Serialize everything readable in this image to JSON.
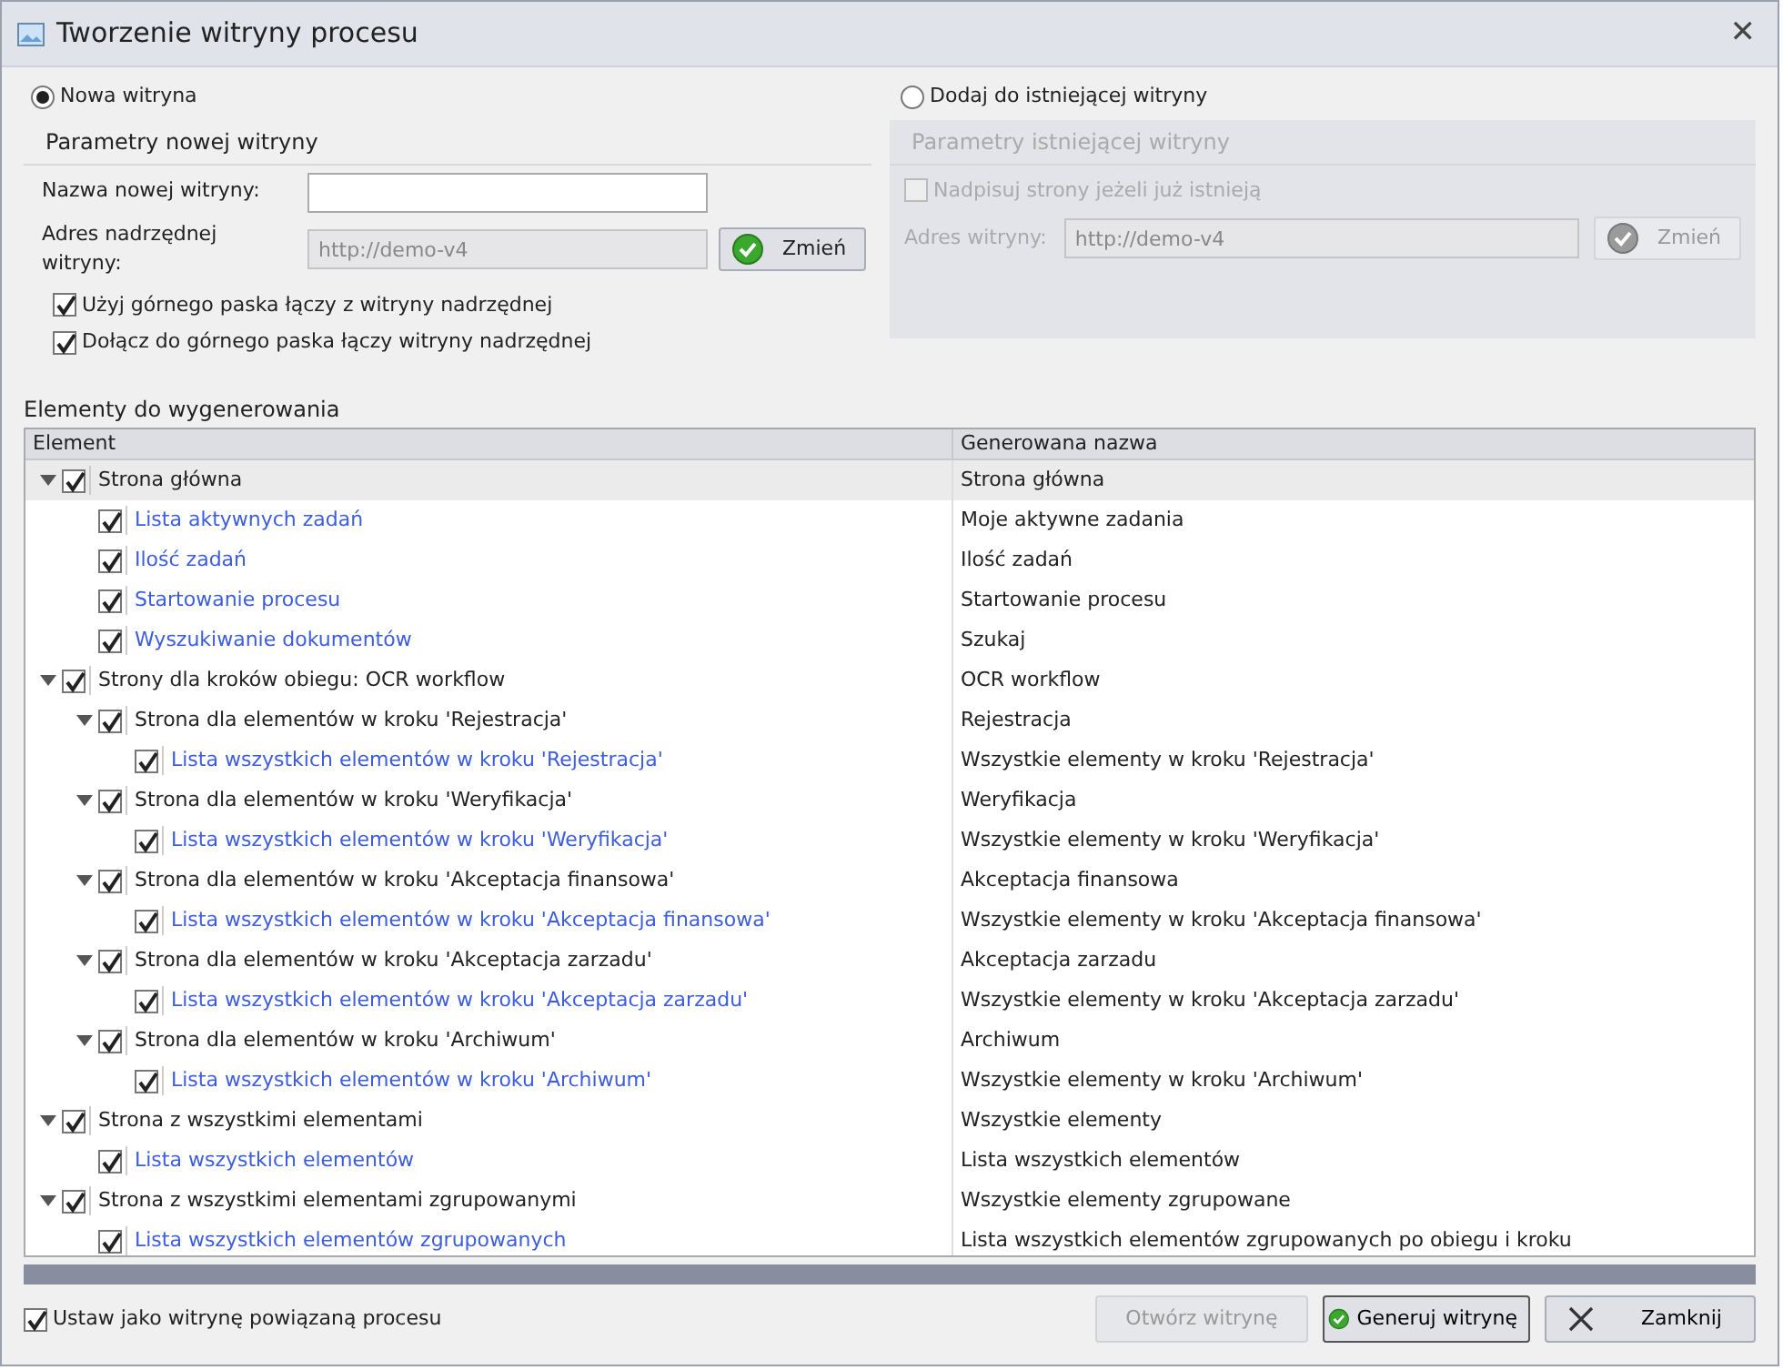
{
  "window": {
    "title": "Tworzenie witryny procesu",
    "close": "✕"
  },
  "mode_options": [
    {
      "label": "Nowa witryna",
      "selected": true
    },
    {
      "label": "Dodaj do istniejącej witryny",
      "selected": false
    }
  ],
  "new_site": {
    "title": "Parametry nowej witryny",
    "disabled": false,
    "name_label": "Nazwa nowej witryny:",
    "parent_label": "Adres nadrzędnej witryny:",
    "parent_value": "http://demo-v4",
    "button": "Zmień",
    "options": [
      {
        "label": "Użyj górnego paska łączy z witryny nadrzędnej",
        "checked": true
      },
      {
        "label": "Dołącz do górnego paska łączy witryny nadrzędnej",
        "checked": true
      }
    ]
  },
  "existing_site": {
    "title": "Parametry istniejącej witryny",
    "disabled": true,
    "overwrite": {
      "label": "Nadpisuj strony jeżeli już istnieją",
      "checked": false
    },
    "address_label": "Adres witryny:",
    "address_value": "http://demo-v4",
    "button": "Zmień"
  },
  "elements": {
    "title": "Elementy do wygenerowania",
    "columns": [
      "Element",
      "Generowana nazwa"
    ],
    "tree": [
      {
        "name": "Strona główna",
        "generated": "Strona główna",
        "checked": true,
        "selected": true,
        "expanded": true,
        "children": [
          {
            "name": "Lista aktywnych zadań",
            "generated": "Moje aktywne zadania",
            "checked": true,
            "selected": false
          },
          {
            "name": "Ilość zadań",
            "generated": "Ilość zadań",
            "checked": true,
            "selected": false
          },
          {
            "name": "Startowanie procesu",
            "generated": "Startowanie procesu",
            "checked": true,
            "selected": false
          },
          {
            "name": "Wyszukiwanie dokumentów",
            "generated": "Szukaj",
            "checked": true,
            "selected": false
          }
        ]
      },
      {
        "name": "Strony dla kroków obiegu: OCR workflow",
        "generated": "OCR workflow",
        "checked": true,
        "selected": false,
        "expanded": true,
        "children": [
          {
            "name": "Strona dla elementów w kroku 'Rejestracja'",
            "generated": "Rejestracja",
            "checked": true,
            "selected": false,
            "expanded": true,
            "children": [
              {
                "name": "Lista wszystkich elementów w kroku 'Rejestracja'",
                "generated": "Wszystkie elementy w kroku 'Rejestracja'",
                "checked": true,
                "selected": false
              }
            ]
          },
          {
            "name": "Strona dla elementów w kroku 'Weryfikacja'",
            "generated": "Weryfikacja",
            "checked": true,
            "selected": false,
            "expanded": true,
            "children": [
              {
                "name": "Lista wszystkich elementów w kroku 'Weryfikacja'",
                "generated": "Wszystkie elementy w kroku 'Weryfikacja'",
                "checked": true,
                "selected": false
              }
            ]
          },
          {
            "name": "Strona dla elementów w kroku 'Akceptacja finansowa'",
            "generated": "Akceptacja finansowa",
            "checked": true,
            "selected": false,
            "expanded": true,
            "children": [
              {
                "name": "Lista wszystkich elementów w kroku 'Akceptacja finansowa'",
                "generated": "Wszystkie elementy w kroku 'Akceptacja finansowa'",
                "checked": true,
                "selected": false
              }
            ]
          },
          {
            "name": "Strona dla elementów w kroku 'Akceptacja zarzadu'",
            "generated": "Akceptacja zarzadu",
            "checked": true,
            "selected": false,
            "expanded": true,
            "children": [
              {
                "name": "Lista wszystkich elementów w kroku 'Akceptacja zarzadu'",
                "generated": "Wszystkie elementy w kroku 'Akceptacja zarzadu'",
                "checked": true,
                "selected": false
              }
            ]
          },
          {
            "name": "Strona dla elementów w kroku 'Archiwum'",
            "generated": "Archiwum",
            "checked": true,
            "selected": false,
            "expanded": true,
            "children": [
              {
                "name": "Lista wszystkich elementów w kroku 'Archiwum'",
                "generated": "Wszystkie elementy w kroku 'Archiwum'",
                "checked": true,
                "selected": false
              }
            ]
          }
        ]
      },
      {
        "name": "Strona z wszystkimi elementami",
        "generated": "Wszystkie elementy",
        "checked": true,
        "selected": false,
        "expanded": true,
        "children": [
          {
            "name": "Lista wszystkich elementów",
            "generated": "Lista wszystkich elementów",
            "checked": true,
            "selected": false
          }
        ]
      },
      {
        "name": "Strona z wszystkimi elementami zgrupowanymi",
        "generated": "Wszystkie elementy zgrupowane",
        "checked": true,
        "selected": false,
        "expanded": true,
        "children": [
          {
            "name": "Lista wszystkich elementów zgrupowanych",
            "generated": "Lista wszystkich elementów zgrupowanych po obiegu i kroku",
            "checked": true,
            "selected": false
          }
        ]
      }
    ]
  },
  "footer": {
    "link_option": {
      "label": "Ustaw jako witrynę powiązaną procesu",
      "checked": true
    },
    "buttons": [
      {
        "kind": "open",
        "label": "Otwórz witrynę",
        "disabled": true
      },
      {
        "kind": "generate",
        "label": "Generuj witrynę",
        "disabled": false
      },
      {
        "kind": "close",
        "label": "Zamknij",
        "disabled": false
      }
    ]
  }
}
